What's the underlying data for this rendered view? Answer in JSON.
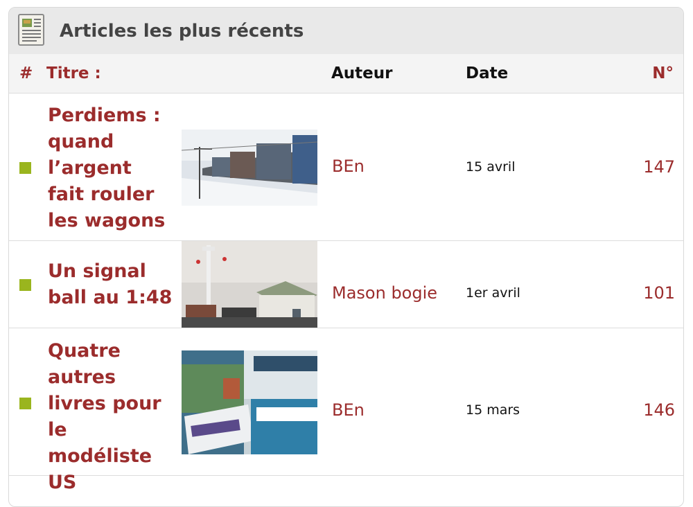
{
  "header": {
    "title": "Articles les plus récents",
    "icon": "newspaper-icon"
  },
  "columns": {
    "hash": "#",
    "title": "Titre :",
    "author": "Auteur",
    "date": "Date",
    "number": "N°"
  },
  "articles": [
    {
      "title": "Perdiems : quand l’argent fait rouler les wagons",
      "author": "BEn",
      "date": "15 avril",
      "number": "147",
      "thumb": "freight-train-snow"
    },
    {
      "title": "Un signal ball au 1:48",
      "author": "Mason bogie",
      "date": "1er avril",
      "number": "101",
      "thumb": "signal-model-scene"
    },
    {
      "title": "Quatre autres livres pour le modéliste US",
      "author": "BEn",
      "date": "15 mars",
      "number": "146",
      "thumb": "model-railroad-books"
    }
  ],
  "colors": {
    "accent": "#9b2c2c",
    "bullet": "#9ab51e",
    "header_bg": "#e9e9e9"
  }
}
